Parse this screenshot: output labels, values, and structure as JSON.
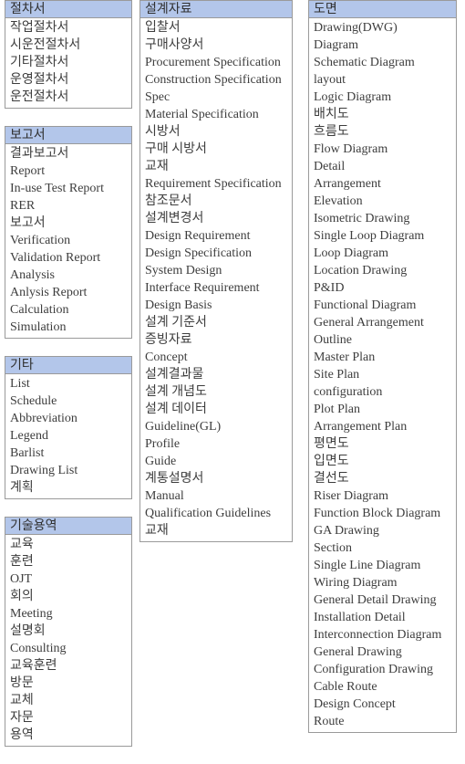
{
  "colors": {
    "header_background": "#b3c6ea",
    "border": "#9a9a9a",
    "text": "#3d3d3d",
    "page_background": "#ffffff"
  },
  "columns": [
    {
      "id": "procedures",
      "name": "left-column",
      "boxes": [
        {
          "id": "procedure-documents",
          "header": "절차서",
          "items": [
            "작업절차서",
            "시운전절차서",
            "기타절차서",
            "운영절차서",
            "운전절차서"
          ]
        },
        {
          "id": "report-documents",
          "header": "보고서",
          "items": [
            "결과보고서",
            "Report",
            "In-use Test Report",
            "RER",
            "보고서",
            "Verification",
            "Validation Report",
            "Analysis",
            "Anlysis Report",
            "Calculation",
            "Simulation"
          ]
        },
        {
          "id": "etc-documents",
          "header": "기타",
          "items": [
            "List",
            "Schedule",
            "Abbreviation",
            "Legend",
            "Barlist",
            "Drawing List",
            "계획"
          ]
        },
        {
          "id": "technical-service-documents",
          "header": "기술용역",
          "items": [
            "교육",
            "훈련",
            "OJT",
            "회의",
            "Meeting",
            "설명회",
            "Consulting",
            "교육훈련",
            "방문",
            "교체",
            "자문",
            "용역"
          ]
        }
      ]
    },
    {
      "id": "design",
      "name": "middle-column",
      "boxes": [
        {
          "id": "design-documents",
          "header": "설계자료",
          "items": [
            "입찰서",
            "구매사양서",
            "Procurement Specification",
            "Construction Specification",
            "Spec",
            "Material Specification",
            "시방서",
            "구매 시방서",
            "교재",
            "Requirement Specification",
            "참조문서",
            "설계변경서",
            "Design Requirement",
            "Design Specification",
            "System Design",
            "Interface Requirement",
            "Design Basis",
            "설계 기준서",
            "증빙자료",
            "Concept",
            "설계결과물",
            "설계 개념도",
            "설계 데이터",
            "Guideline(GL)",
            "Profile",
            "Guide",
            "계통설명서",
            "Manual",
            "Qualification Guidelines",
            "교재"
          ]
        }
      ]
    },
    {
      "id": "drawings",
      "name": "right-column",
      "boxes": [
        {
          "id": "drawing-documents",
          "header": "도면",
          "items": [
            "Drawing(DWG)",
            "Diagram",
            "Schematic Diagram",
            "layout",
            "Logic Diagram",
            "배치도",
            "흐름도",
            "Flow Diagram",
            "Detail",
            "Arrangement",
            "Elevation",
            "Isometric Drawing",
            "Single Loop Diagram",
            "Loop Diagram",
            "Location Drawing",
            "P&ID",
            "Functional Diagram",
            "General Arrangement",
            "Outline",
            "Master Plan",
            "Site Plan",
            "configuration",
            "Plot Plan",
            "Arrangement Plan",
            "평면도",
            "입면도",
            "결선도",
            "Riser Diagram",
            "Function Block Diagram",
            "GA Drawing",
            "Section",
            "Single Line Diagram",
            "Wiring Diagram",
            "General Detail Drawing",
            "Installation Detail",
            "Interconnection Diagram",
            "General Drawing",
            "Configuration Drawing",
            "Cable Route",
            "Design Concept",
            "Route"
          ]
        }
      ]
    }
  ]
}
